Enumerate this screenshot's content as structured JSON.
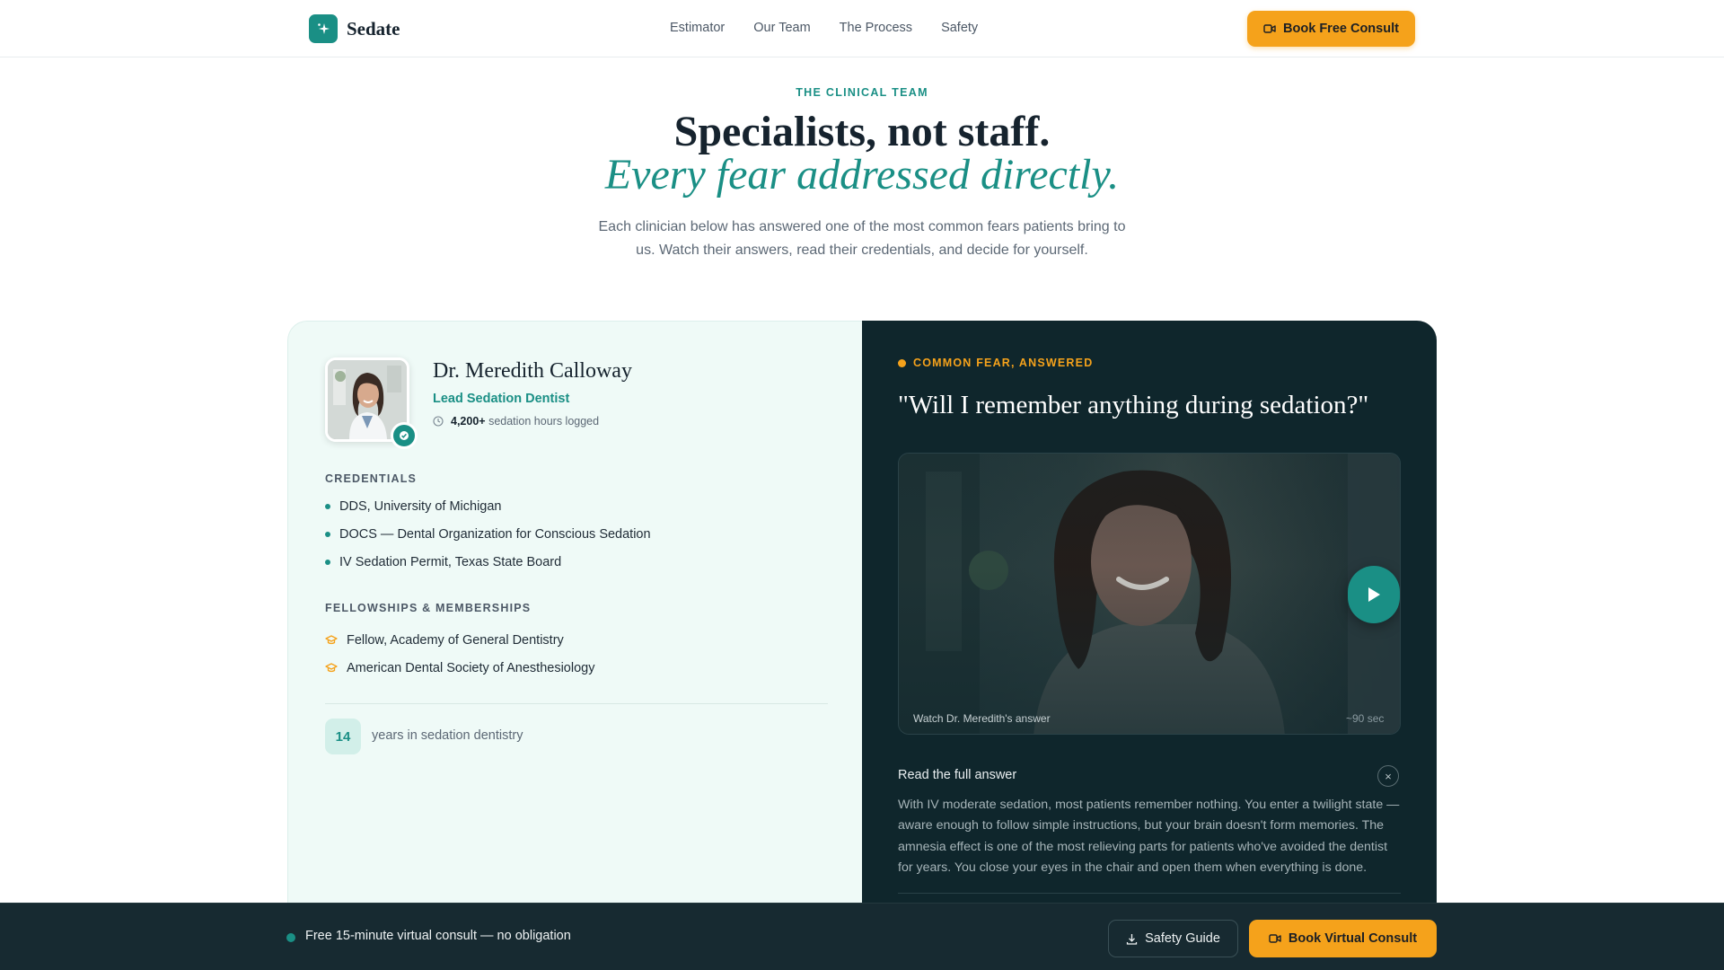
{
  "nav": {
    "brand": "Sedate",
    "links": [
      "Estimator",
      "Our Team",
      "The Process",
      "Safety"
    ],
    "cta": "Book Free Consult"
  },
  "hero": {
    "eyebrow": "THE CLINICAL TEAM",
    "title": "Specialists, not staff.",
    "title_accent": "Every fear addressed directly.",
    "lead": "Each clinician below has answered one of the most common fears patients bring to us. Watch their answers, read their credentials, and decide for yourself."
  },
  "doctor": {
    "name": "Dr. Meredith Calloway",
    "role": "Lead Sedation Dentist",
    "hours_value": "4,200+",
    "hours_label": "sedation hours logged",
    "credentials_title": "CREDENTIALS",
    "credentials": [
      "DDS, University of Michigan",
      "DOCS — Dental Organization for Conscious Sedation",
      "IV Sedation Permit, Texas State Board"
    ],
    "fellowships_title": "FELLOWSHIPS & MEMBERSHIPS",
    "fellowships": [
      "Fellow, Academy of General Dentistry",
      "American Dental Society of Anesthesiology"
    ],
    "years_value": "14",
    "years_label": "years in sedation dentistry"
  },
  "fear": {
    "eyebrow": "COMMON FEAR, ANSWERED",
    "question": "\"Will I remember anything during sedation?\"",
    "video_caption": "Watch Dr. Meredith's answer",
    "video_duration": "~90 sec",
    "answer_title": "Read the full answer",
    "answer_body": "With IV moderate sedation, most patients remember nothing. You enter a twilight state — aware enough to follow simple instructions, but your brain doesn't form memories. The amnesia effect is one of the most relieving parts for patients who've avoided the dentist for years. You close your eyes in the chair and open them when everything is done."
  },
  "bottom_bar": {
    "text": "Free 15-minute virtual consult — no obligation",
    "guide": "Safety Guide",
    "cta": "Book Virtual Consult"
  },
  "colors": {
    "accent_teal": "#1a8f85",
    "accent_amber": "#f5a21b",
    "dark_panel": "#0f262c"
  }
}
